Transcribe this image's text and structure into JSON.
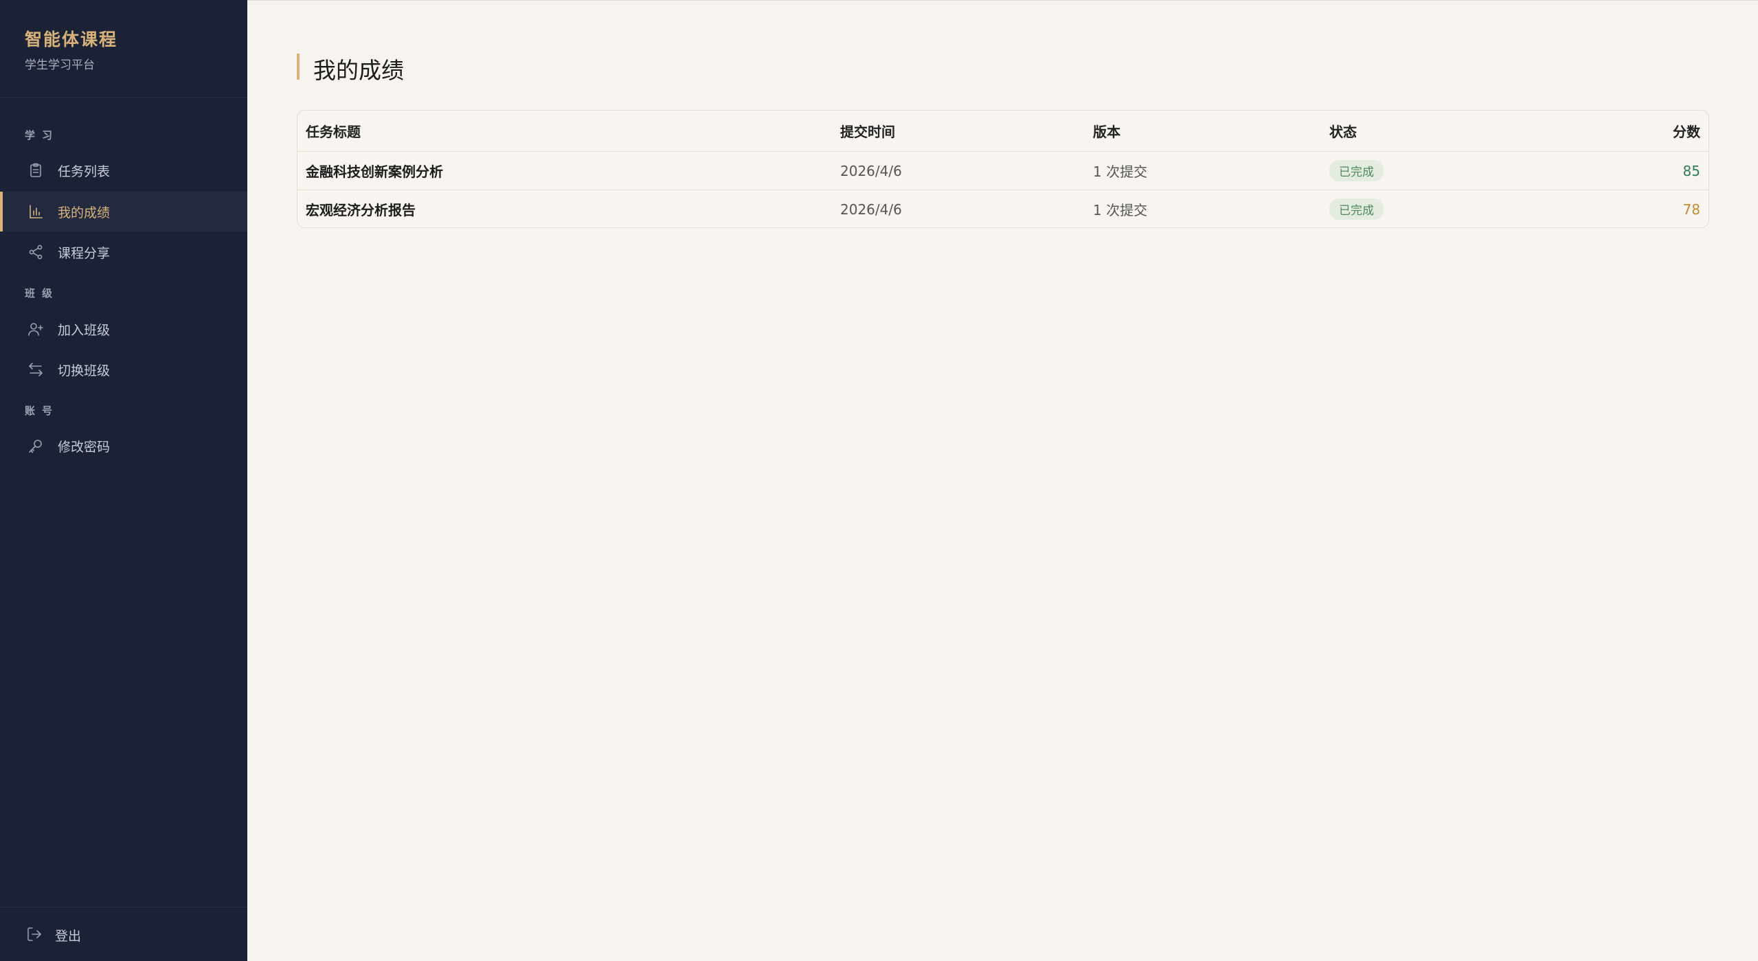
{
  "brand": {
    "title": "智能体课程",
    "subtitle": "学生学习平台"
  },
  "nav": {
    "sections": [
      "学习",
      "班级",
      "账号"
    ],
    "items": [
      {
        "label": "任务列表",
        "icon": "clipboard-icon"
      },
      {
        "label": "我的成绩",
        "icon": "bar-chart-icon",
        "active": true
      },
      {
        "label": "课程分享",
        "icon": "share-icon"
      },
      {
        "label": "加入班级",
        "icon": "user-plus-icon"
      },
      {
        "label": "切换班级",
        "icon": "switch-icon"
      },
      {
        "label": "修改密码",
        "icon": "key-icon"
      }
    ],
    "logout": "登出"
  },
  "page": {
    "title": "我的成绩"
  },
  "table": {
    "headers": [
      "任务标题",
      "提交时间",
      "版本",
      "状态",
      "分数"
    ],
    "rows": [
      {
        "title": "金融科技创新案例分析",
        "time": "2026/4/6",
        "version": "1 次提交",
        "status": "已完成",
        "score": "85"
      },
      {
        "title": "宏观经济分析报告",
        "time": "2026/4/6",
        "version": "1 次提交",
        "status": "已完成",
        "score": "78"
      }
    ]
  },
  "colors": {
    "sidebar_bg": "#1b2236",
    "accent": "#d7b27a",
    "page_bg": "#f7f4ef",
    "status_green": "#4f8a5b",
    "score_high": "#2e7d55",
    "score_mid": "#c58a2e"
  }
}
